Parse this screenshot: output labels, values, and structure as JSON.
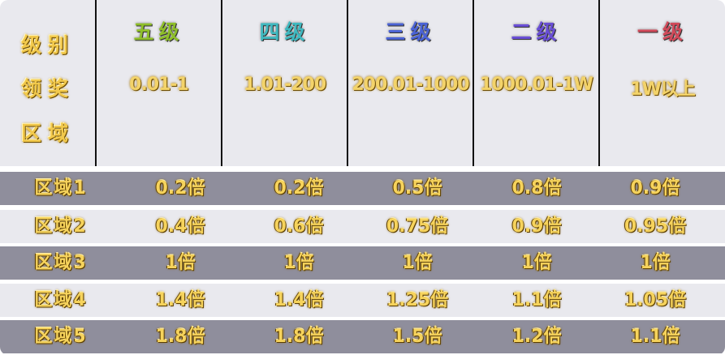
{
  "header": {
    "row_label": [
      "级别",
      "领奖",
      "区域"
    ],
    "levels": [
      {
        "name": "五级",
        "color": "#8fbf2a",
        "range": "0.01-1"
      },
      {
        "name": "四级",
        "color": "#3fb9c0",
        "range": "1.01-200"
      },
      {
        "name": "三级",
        "color": "#4b63d6",
        "range": "200.01-1000"
      },
      {
        "name": "二级",
        "color": "#6a4fd6",
        "range": "1000.01-1W"
      },
      {
        "name": "一级",
        "color": "#d14a5a",
        "range": "1W以上"
      }
    ]
  },
  "rows": [
    {
      "area": "区域1",
      "values": [
        "0.2倍",
        "0.2倍",
        "0.5倍",
        "0.8倍",
        "0.9倍"
      ]
    },
    {
      "area": "区域2",
      "values": [
        "0.4倍",
        "0.6倍",
        "0.75倍",
        "0.9倍",
        "0.95倍"
      ]
    },
    {
      "area": "区域3",
      "values": [
        "1倍",
        "1倍",
        "1倍",
        "1倍",
        "1倍"
      ]
    },
    {
      "area": "区域4",
      "values": [
        "1.4倍",
        "1.4倍",
        "1.25倍",
        "1.1倍",
        "1.05倍"
      ]
    },
    {
      "area": "区域5",
      "values": [
        "1.8倍",
        "1.8倍",
        "1.5倍",
        "1.2倍",
        "1.1倍"
      ]
    }
  ],
  "colors": {
    "header_bg": "#e9e9ee",
    "row_dark": "#8f8e9c",
    "row_light": "#e9e9ee",
    "text_gold": "#f6d35c"
  }
}
